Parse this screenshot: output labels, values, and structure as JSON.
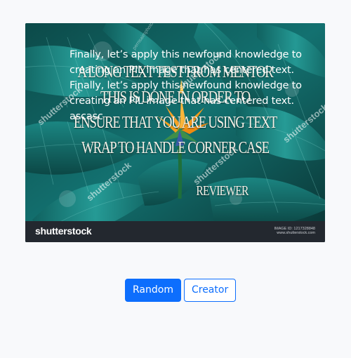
{
  "image": {
    "meme_top_lines": [
      "A LONG TEXT TEST FROM MENTOR",
      "THIS IS DONE IN ORDER TO",
      "ENSURE THAT YOU ARE USING TEXT",
      "WRAP TO HANDLE CORNER CASE"
    ],
    "meme_bottom": "REVIEWER",
    "overlay_text": "Finally, let’s apply this newfound knowledge to creating an PIL image that has centered text. Finally, let’s apply this newfound knowledge to creating an PIL image that has centered text. ascasc",
    "brand": "shutterstock",
    "image_id_line1": "IMAGE ID: 1217328848",
    "image_id_line2": "www.shutterstock.com",
    "watermarks": [
      "shutterstock",
      "shutterstock",
      "shutterstock",
      "shutterstock",
      "shutterstock"
    ],
    "small_watermark": "pernsaimphoto"
  },
  "buttons": {
    "random_label": "Random",
    "creator_label": "Creator"
  },
  "colors": {
    "primary": "#0d6efd",
    "footer": "#23282f",
    "leaf_teal": "#1a8a86",
    "flower_orange": "#f59a1b"
  }
}
